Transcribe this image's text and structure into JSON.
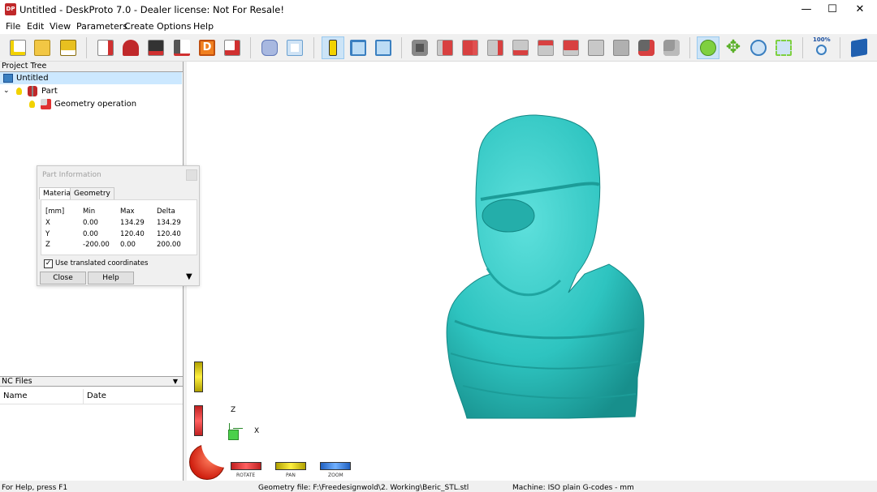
{
  "window": {
    "icon_text": "DP",
    "title": "Untitled - DeskProto 7.0 - Dealer license: Not For Resale!",
    "minimize": "—",
    "maximize": "☐",
    "close": "✕"
  },
  "menu": [
    "File",
    "Edit",
    "View",
    "Parameters",
    "Create",
    "Options",
    "Help"
  ],
  "toolbar": {
    "zoom_percent": "100%",
    "icons": [
      "new-project-icon",
      "open-project-icon",
      "save-project-icon",
      "import-geometry-icon",
      "place-part-icon",
      "bitmap-icon",
      "toolpath-icon",
      "drawing-icon",
      "save-nc-icon",
      "simulate-icon",
      "inspect-icon",
      "part-information-icon",
      "split-view-icon",
      "preview-icon",
      "camera-icon",
      "view-front-icon",
      "view-back-icon",
      "view-left-icon",
      "view-right-icon",
      "view-top-icon",
      "view-bottom-icon",
      "view-iso1-icon",
      "view-iso2-icon",
      "previous-view-icon",
      "next-view-icon",
      "rotate-mode-icon",
      "pan-mode-icon",
      "zoom-mode-icon",
      "zoom-window-icon",
      "zoom-fit-icon",
      "help-book-icon"
    ]
  },
  "project_tree": {
    "header": "Project Tree",
    "root": "Untitled",
    "part": "Part",
    "operation": "Geometry operation"
  },
  "nc_files": {
    "header": "NC Files",
    "columns": [
      "Name",
      "Date"
    ]
  },
  "part_info": {
    "title": "Part Information",
    "tabs": [
      "Material",
      "Geometry"
    ],
    "unit": "[mm]",
    "columns": [
      "Min",
      "Max",
      "Delta"
    ],
    "rows": [
      {
        "axis": "X",
        "min": "0.00",
        "max": "134.29",
        "delta": "134.29"
      },
      {
        "axis": "Y",
        "min": "0.00",
        "max": "120.40",
        "delta": "120.40"
      },
      {
        "axis": "Z",
        "min": "-200.00",
        "max": "0.00",
        "delta": "200.00"
      }
    ],
    "checkbox_label": "Use translated coordinates",
    "checkbox_checked": true,
    "close_label": "Close",
    "help_label": "Help"
  },
  "viewport": {
    "axis_z": "Z",
    "axis_x": "X",
    "model_color": "#2ec4c0",
    "mode_labels": {
      "rotate": "ROTATE",
      "pan": "PAN",
      "zoom": "ZOOM"
    }
  },
  "status": {
    "help": "For Help, press F1",
    "geometry_file": "Geometry file: F:\\Freedesignwold\\2. Working\\Beric_STL.stl",
    "machine": "Machine: ISO plain G-codes - mm"
  }
}
